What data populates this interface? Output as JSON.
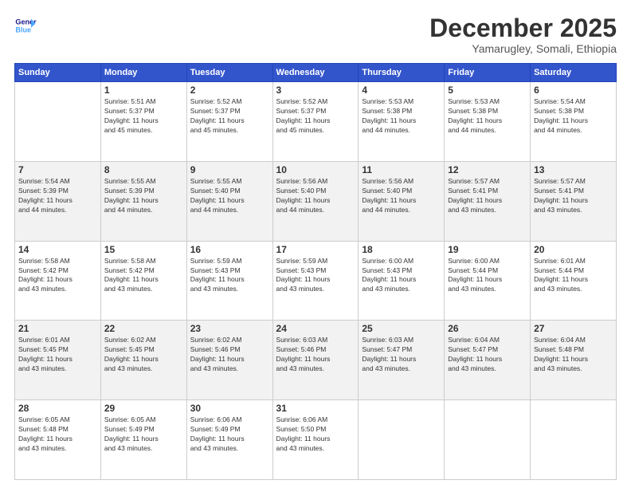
{
  "logo": {
    "line1": "General",
    "line2": "Blue"
  },
  "header": {
    "month": "December 2025",
    "location": "Yamarugley, Somali, Ethiopia"
  },
  "weekdays": [
    "Sunday",
    "Monday",
    "Tuesday",
    "Wednesday",
    "Thursday",
    "Friday",
    "Saturday"
  ],
  "weeks": [
    [
      {
        "day": "",
        "info": ""
      },
      {
        "day": "1",
        "info": "Sunrise: 5:51 AM\nSunset: 5:37 PM\nDaylight: 11 hours\nand 45 minutes."
      },
      {
        "day": "2",
        "info": "Sunrise: 5:52 AM\nSunset: 5:37 PM\nDaylight: 11 hours\nand 45 minutes."
      },
      {
        "day": "3",
        "info": "Sunrise: 5:52 AM\nSunset: 5:37 PM\nDaylight: 11 hours\nand 45 minutes."
      },
      {
        "day": "4",
        "info": "Sunrise: 5:53 AM\nSunset: 5:38 PM\nDaylight: 11 hours\nand 44 minutes."
      },
      {
        "day": "5",
        "info": "Sunrise: 5:53 AM\nSunset: 5:38 PM\nDaylight: 11 hours\nand 44 minutes."
      },
      {
        "day": "6",
        "info": "Sunrise: 5:54 AM\nSunset: 5:38 PM\nDaylight: 11 hours\nand 44 minutes."
      }
    ],
    [
      {
        "day": "7",
        "info": "Sunrise: 5:54 AM\nSunset: 5:39 PM\nDaylight: 11 hours\nand 44 minutes."
      },
      {
        "day": "8",
        "info": "Sunrise: 5:55 AM\nSunset: 5:39 PM\nDaylight: 11 hours\nand 44 minutes."
      },
      {
        "day": "9",
        "info": "Sunrise: 5:55 AM\nSunset: 5:40 PM\nDaylight: 11 hours\nand 44 minutes."
      },
      {
        "day": "10",
        "info": "Sunrise: 5:56 AM\nSunset: 5:40 PM\nDaylight: 11 hours\nand 44 minutes."
      },
      {
        "day": "11",
        "info": "Sunrise: 5:56 AM\nSunset: 5:40 PM\nDaylight: 11 hours\nand 44 minutes."
      },
      {
        "day": "12",
        "info": "Sunrise: 5:57 AM\nSunset: 5:41 PM\nDaylight: 11 hours\nand 43 minutes."
      },
      {
        "day": "13",
        "info": "Sunrise: 5:57 AM\nSunset: 5:41 PM\nDaylight: 11 hours\nand 43 minutes."
      }
    ],
    [
      {
        "day": "14",
        "info": "Sunrise: 5:58 AM\nSunset: 5:42 PM\nDaylight: 11 hours\nand 43 minutes."
      },
      {
        "day": "15",
        "info": "Sunrise: 5:58 AM\nSunset: 5:42 PM\nDaylight: 11 hours\nand 43 minutes."
      },
      {
        "day": "16",
        "info": "Sunrise: 5:59 AM\nSunset: 5:43 PM\nDaylight: 11 hours\nand 43 minutes."
      },
      {
        "day": "17",
        "info": "Sunrise: 5:59 AM\nSunset: 5:43 PM\nDaylight: 11 hours\nand 43 minutes."
      },
      {
        "day": "18",
        "info": "Sunrise: 6:00 AM\nSunset: 5:43 PM\nDaylight: 11 hours\nand 43 minutes."
      },
      {
        "day": "19",
        "info": "Sunrise: 6:00 AM\nSunset: 5:44 PM\nDaylight: 11 hours\nand 43 minutes."
      },
      {
        "day": "20",
        "info": "Sunrise: 6:01 AM\nSunset: 5:44 PM\nDaylight: 11 hours\nand 43 minutes."
      }
    ],
    [
      {
        "day": "21",
        "info": "Sunrise: 6:01 AM\nSunset: 5:45 PM\nDaylight: 11 hours\nand 43 minutes."
      },
      {
        "day": "22",
        "info": "Sunrise: 6:02 AM\nSunset: 5:45 PM\nDaylight: 11 hours\nand 43 minutes."
      },
      {
        "day": "23",
        "info": "Sunrise: 6:02 AM\nSunset: 5:46 PM\nDaylight: 11 hours\nand 43 minutes."
      },
      {
        "day": "24",
        "info": "Sunrise: 6:03 AM\nSunset: 5:46 PM\nDaylight: 11 hours\nand 43 minutes."
      },
      {
        "day": "25",
        "info": "Sunrise: 6:03 AM\nSunset: 5:47 PM\nDaylight: 11 hours\nand 43 minutes."
      },
      {
        "day": "26",
        "info": "Sunrise: 6:04 AM\nSunset: 5:47 PM\nDaylight: 11 hours\nand 43 minutes."
      },
      {
        "day": "27",
        "info": "Sunrise: 6:04 AM\nSunset: 5:48 PM\nDaylight: 11 hours\nand 43 minutes."
      }
    ],
    [
      {
        "day": "28",
        "info": "Sunrise: 6:05 AM\nSunset: 5:48 PM\nDaylight: 11 hours\nand 43 minutes."
      },
      {
        "day": "29",
        "info": "Sunrise: 6:05 AM\nSunset: 5:49 PM\nDaylight: 11 hours\nand 43 minutes."
      },
      {
        "day": "30",
        "info": "Sunrise: 6:06 AM\nSunset: 5:49 PM\nDaylight: 11 hours\nand 43 minutes."
      },
      {
        "day": "31",
        "info": "Sunrise: 6:06 AM\nSunset: 5:50 PM\nDaylight: 11 hours\nand 43 minutes."
      },
      {
        "day": "",
        "info": ""
      },
      {
        "day": "",
        "info": ""
      },
      {
        "day": "",
        "info": ""
      }
    ]
  ]
}
